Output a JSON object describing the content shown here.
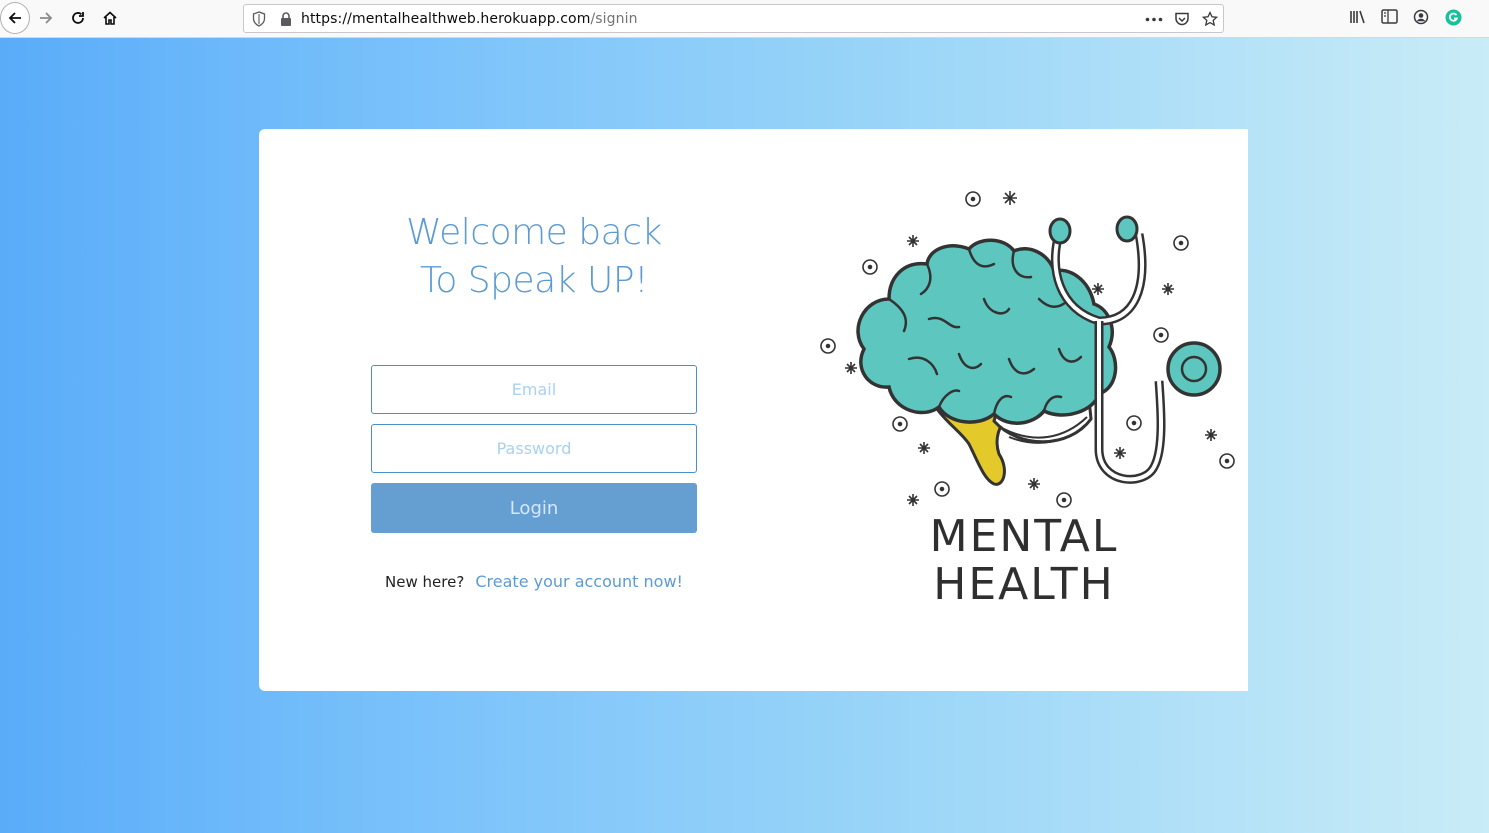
{
  "browser": {
    "url_host": "https://mentalhealthweb.herokuapp.com",
    "url_path": "/signin",
    "icons": [
      "back-arrow-icon",
      "forward-arrow-icon",
      "reload-icon",
      "home-icon",
      "shield-icon",
      "lock-icon",
      "more-icon",
      "pocket-icon",
      "star-icon",
      "library-icon",
      "sidebar-icon",
      "account-icon",
      "grammarly-icon"
    ]
  },
  "page": {
    "background_start": "#5aacf9",
    "background_end": "#c9ecf7"
  },
  "signin": {
    "title_line1": "Welcome back",
    "title_line2": "To Speak UP!",
    "email_placeholder": "Email",
    "password_placeholder": "Password",
    "login_label": "Login",
    "new_here": "New here?",
    "create_account": "Create your account now!",
    "accent": "#5b9bd5"
  },
  "illustration": {
    "line1": "MENTAL",
    "line2": "HEALTH",
    "brain_color": "#5cc6bf",
    "stem_color": "#e3ca2a"
  }
}
